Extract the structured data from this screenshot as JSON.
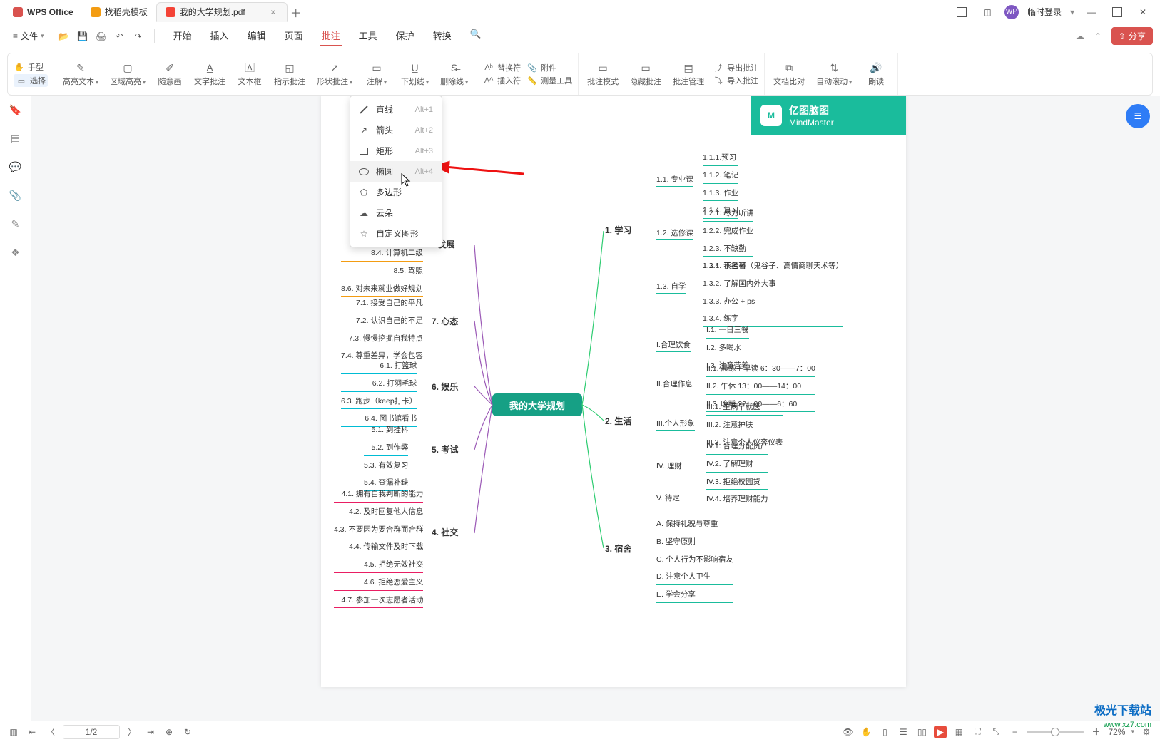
{
  "titlebar": {
    "app": "WPS Office",
    "tab_templates": "找稻壳模板",
    "tab_active": "我的大学规划.pdf",
    "login": "临时登录"
  },
  "menubar": {
    "file": "文件",
    "items": [
      "开始",
      "插入",
      "编辑",
      "页面",
      "批注",
      "工具",
      "保护",
      "转换"
    ],
    "active_index": 4,
    "share": "分享"
  },
  "ribbon": {
    "hand": "手型",
    "select": "选择",
    "highlight": "高亮文本",
    "areaHighlight": "区域高亮",
    "freehand": "随意画",
    "textAnnot": "文字批注",
    "textbox": "文本框",
    "pointAnnot": "指示批注",
    "shapeAnnot": "形状批注",
    "annotate": "注解",
    "underline": "下划线",
    "strike": "删除线",
    "replace": "替换符",
    "attach": "附件",
    "insertChar": "插入符",
    "measure": "测量工具",
    "annotMode": "批注模式",
    "hideAnnot": "隐藏批注",
    "annotMgr": "批注管理",
    "exportAnnot": "导出批注",
    "importAnnot": "导入批注",
    "docCompare": "文档比对",
    "autoScroll": "自动滚动",
    "read": "朗读"
  },
  "dropdown": {
    "items": [
      {
        "label": "直线",
        "sc": "Alt+1",
        "icon": "line"
      },
      {
        "label": "箭头",
        "sc": "Alt+2",
        "icon": "arrow"
      },
      {
        "label": "矩形",
        "sc": "Alt+3",
        "icon": "rect"
      },
      {
        "label": "椭圆",
        "sc": "Alt+4",
        "icon": "ellipse"
      },
      {
        "label": "多边形",
        "sc": "",
        "icon": "poly"
      },
      {
        "label": "云朵",
        "sc": "",
        "icon": "cloud"
      },
      {
        "label": "自定义图形",
        "sc": "",
        "icon": "star"
      }
    ],
    "hover_index": 3
  },
  "mindmap": {
    "badge_cn": "亿图脑图",
    "badge_en": "MindMaster",
    "center": "我的大学规划",
    "right": [
      {
        "title": "1. 学习",
        "color": "c-teal",
        "sub": [
          {
            "label": "1.1. 专业课",
            "leaves": [
              "1.1.1.预习",
              "1.1.2. 笔记",
              "1.1.3. 作业",
              "1.1.4. 复习"
            ]
          },
          {
            "label": "1.2. 选修课",
            "leaves": [
              "1.2.1. 尽力听讲",
              "1.2.2. 完成作业",
              "1.2.3. 不缺勤",
              "1.2.4. 不挂科"
            ]
          },
          {
            "label": "1.3. 自学",
            "leaves": [
              "1.3.1. 读名著（鬼谷子、高情商聊天术等）",
              "1.3.2. 了解国内外大事",
              "1.3.3. 办公 + ps",
              "1.3.4. 练字"
            ]
          }
        ]
      },
      {
        "title": "2. 生活",
        "color": "c-teal",
        "sub": [
          {
            "label": "I.合理饮食",
            "leaves": [
              "I.1. 一日三餐",
              "I.2. 多喝水",
              "I.3. 注意营养"
            ]
          },
          {
            "label": "II.合理作息",
            "leaves": [
              "II.1. 晨练＋早读 6：30——7：00",
              "II.2. 午休  13：00——14：00",
              "II.3. 晚睡  22：00——6：60"
            ]
          },
          {
            "label": "III.个人形象",
            "leaves": [
              "III.1. 生病早就医",
              "III.2. 注意护肤",
              "III.3. 注意个人仪容仪表"
            ]
          },
          {
            "label": "IV. 理财",
            "leaves": [
              "IV.1. 合理分配资产",
              "IV.2. 了解理财",
              "IV.3. 拒绝校园贷",
              "IV.4. 培养理财能力"
            ]
          },
          {
            "label": "V. 待定",
            "leaves": []
          }
        ]
      },
      {
        "title": "3. 宿舍",
        "color": "c-teal",
        "sub": [
          {
            "label": "",
            "leaves": [
              "A. 保持礼貌与尊重",
              "B. 坚守原则",
              "C. 个人行为不影响宿友",
              "D. 注意个人卫生",
              "E. 学会分享"
            ]
          }
        ]
      }
    ],
    "left": [
      {
        "title": "8. 发展",
        "color": "c-orange",
        "leaves": [
          "8.4. 计算机二级",
          "8.5. 驾照",
          "8.6. 对未来就业做好规划"
        ]
      },
      {
        "title": "7. 心态",
        "color": "c-orange",
        "leaves": [
          "7.1. 接受自己的平凡",
          "7.2. 认识自己的不足",
          "7.3. 慢慢挖掘自我特点",
          "7.4. 尊重差异，学会包容"
        ]
      },
      {
        "title": "6. 娱乐",
        "color": "c-cyan",
        "leaves": [
          "6.1. 打篮球",
          "6.2. 打羽毛球",
          "6.3. 跑步（keep打卡）",
          "6.4. 图书馆看书"
        ]
      },
      {
        "title": "5. 考试",
        "color": "c-cyan",
        "leaves": [
          "5.1. 到挂科",
          "5.2. 到作弊",
          "5.3. 有效复习",
          "5.4. 查漏补缺"
        ]
      },
      {
        "title": "4. 社交",
        "color": "c-pink",
        "leaves": [
          "4.1. 拥有自我判断的能力",
          "4.2. 及时回复他人信息",
          "4.3. 不要因为要合群而合群",
          "4.4. 传输文件及时下载",
          "4.5. 拒绝无效社交",
          "4.6. 拒绝恋爱主义",
          "4.7. 参加一次志愿者活动"
        ]
      }
    ]
  },
  "statusbar": {
    "page": "1/2",
    "zoom": "72%"
  },
  "watermark": {
    "line1": "极光下载站",
    "line2": "www.xz7.com"
  }
}
